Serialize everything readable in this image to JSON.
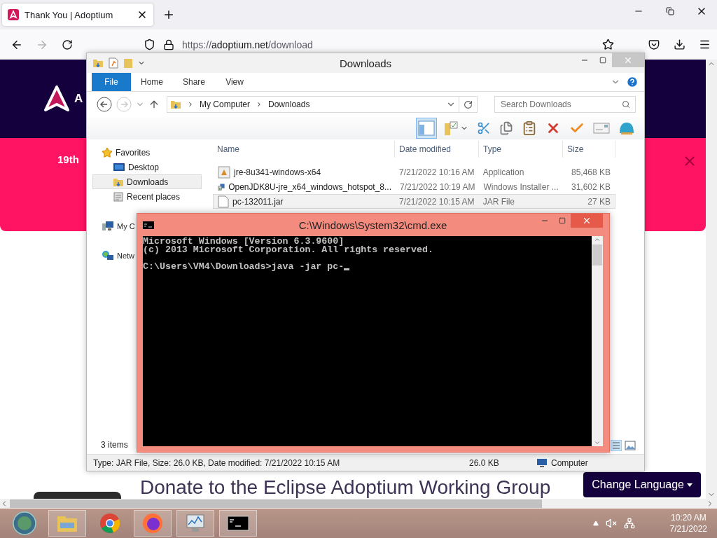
{
  "browser": {
    "tab": {
      "title": "Thank You | Adoptium"
    },
    "url": {
      "scheme": "https://",
      "host": "adoptium.net",
      "path": "/download"
    },
    "page": {
      "brand_letter": "A",
      "banner_text": "19th",
      "heading": "Donate to the Eclipse Adoptium Working Group",
      "language_button": "Change Language"
    }
  },
  "explorer": {
    "title": "Downloads",
    "ribbon_tabs": [
      {
        "label": "File",
        "selected": true
      },
      {
        "label": "Home",
        "selected": false
      },
      {
        "label": "Share",
        "selected": false
      },
      {
        "label": "View",
        "selected": false
      }
    ],
    "breadcrumb": [
      "My Computer",
      "Downloads"
    ],
    "search": {
      "placeholder": "Search Downloads"
    },
    "nav": [
      {
        "label": "Favorites",
        "kind": "group",
        "selected": false
      },
      {
        "label": "Desktop",
        "kind": "place",
        "selected": false
      },
      {
        "label": "Downloads",
        "kind": "place",
        "selected": true
      },
      {
        "label": "Recent places",
        "kind": "place",
        "selected": false
      },
      {
        "label": "My C",
        "kind": "group",
        "selected": false
      },
      {
        "label": "Netw",
        "kind": "group",
        "selected": false
      }
    ],
    "columns": [
      "Name",
      "Date modified",
      "Type",
      "Size"
    ],
    "files": [
      {
        "name": "jre-8u341-windows-x64",
        "date": "7/21/2022 10:16 AM",
        "type": "Application",
        "size": "85,468 KB",
        "kind": "app",
        "selected": false
      },
      {
        "name": "OpenJDK8U-jre_x64_windows_hotspot_8...",
        "date": "7/21/2022 10:19 AM",
        "type": "Windows Installer ...",
        "size": "31,602 KB",
        "kind": "installer",
        "selected": false
      },
      {
        "name": "pc-132011.jar",
        "date": "7/21/2022 10:15 AM",
        "type": "JAR File",
        "size": "27 KB",
        "kind": "jar",
        "selected": true
      }
    ],
    "item_count": "3 items",
    "status_bar": {
      "details": "Type: JAR File, Size: 26.0 KB, Date modified: 7/21/2022 10:15 AM",
      "size": "26.0 KB",
      "zone": "Computer"
    }
  },
  "console": {
    "title": "C:\\Windows\\System32\\cmd.exe",
    "blocks": [
      {
        "lines": [
          "Microsoft Windows [Version 6.3.9600]",
          "(c) 2013 Microsoft Corporation. All rights reserved."
        ]
      },
      {
        "lines": [
          "C:\\Users\\VM4\\Downloads>java -jar pc-"
        ]
      }
    ]
  },
  "taskbar": {
    "time": "10:20 AM",
    "date": "7/21/2022"
  }
}
